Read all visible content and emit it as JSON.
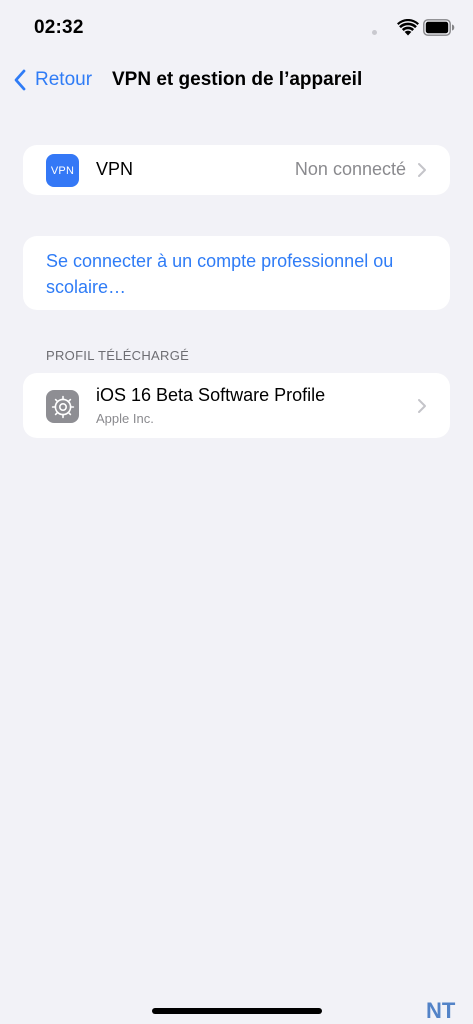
{
  "status_bar": {
    "time": "02:32",
    "icons": [
      "wifi-icon",
      "battery-icon"
    ]
  },
  "nav": {
    "back_label": "Retour",
    "title": "VPN et gestion de l’appareil"
  },
  "vpn_row": {
    "icon_label": "VPN",
    "title": "VPN",
    "status": "Non connecté"
  },
  "work_account": {
    "link_text": "Se connecter à un compte professionnel ou scolaire…"
  },
  "profile_section": {
    "header": "PROFIL TÉLÉCHARGÉ",
    "items": [
      {
        "title": "iOS 16 Beta Software Profile",
        "subtitle": "Apple Inc.",
        "icon": "gear-icon"
      }
    ]
  },
  "watermark": {
    "text": "NT"
  },
  "colors": {
    "background": "#f2f2f7",
    "accent": "#2f7cf6",
    "vpn_icon": "#3478f6",
    "profile_icon": "#8e8e93",
    "secondary_text": "#8a8a8e"
  }
}
